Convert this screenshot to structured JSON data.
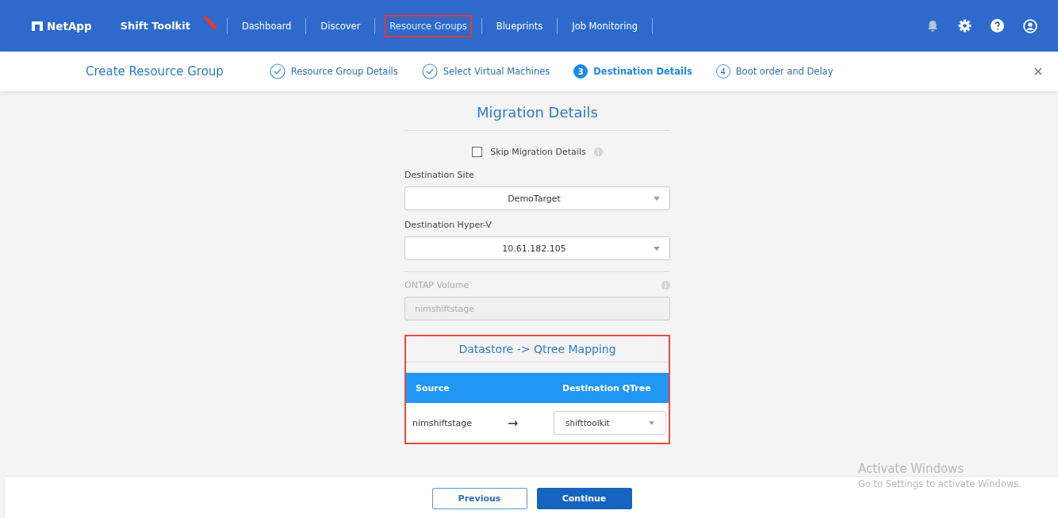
{
  "header": {
    "brand": "NetApp",
    "product": "Shift Toolkit",
    "nav": [
      {
        "label": "Dashboard",
        "highlighted": false
      },
      {
        "label": "Discover",
        "highlighted": false
      },
      {
        "label": "Resource Groups",
        "highlighted": true
      },
      {
        "label": "Blueprints",
        "highlighted": false
      },
      {
        "label": "Job Monitoring",
        "highlighted": false
      }
    ]
  },
  "wizard": {
    "title": "Create Resource Group",
    "steps": [
      {
        "label": "Resource Group Details",
        "completed": true,
        "selected": false
      },
      {
        "label": "Select Virtual Machines",
        "completed": true,
        "selected": false
      },
      {
        "number": "3",
        "label": "Destination Details",
        "completed": false,
        "selected": true
      },
      {
        "number": "4",
        "label": "Boot order and Delay",
        "completed": false,
        "selected": false
      }
    ]
  },
  "form": {
    "title": "Migration Details",
    "skip": {
      "label": "Skip Migration Details",
      "checked": false
    },
    "fields": [
      {
        "label": "Destination Site",
        "value": "DemoTarget",
        "kind": "select",
        "disabled": false
      },
      {
        "label": "Destination Hyper-V",
        "value": "10.61.182.105",
        "kind": "select",
        "disabled": false
      },
      {
        "label": "ONTAP Volume",
        "value": "nimshiftstage",
        "kind": "text",
        "disabled": true
      }
    ],
    "mapping": {
      "title": "Datastore -> Qtree Mapping",
      "highlighted": true,
      "columns": [
        "Source",
        "Destination QTree"
      ],
      "rows": [
        {
          "source": "nimshiftstage",
          "arrow": "→",
          "destination": "shifttoolkit"
        }
      ]
    }
  },
  "footer": {
    "buttons": [
      {
        "label": "Previous",
        "kind": "secondary"
      },
      {
        "label": "Continue",
        "kind": "primary"
      }
    ]
  },
  "os_notice": {
    "title": "Activate Windows",
    "text": "Go to Settings to activate Windows."
  }
}
